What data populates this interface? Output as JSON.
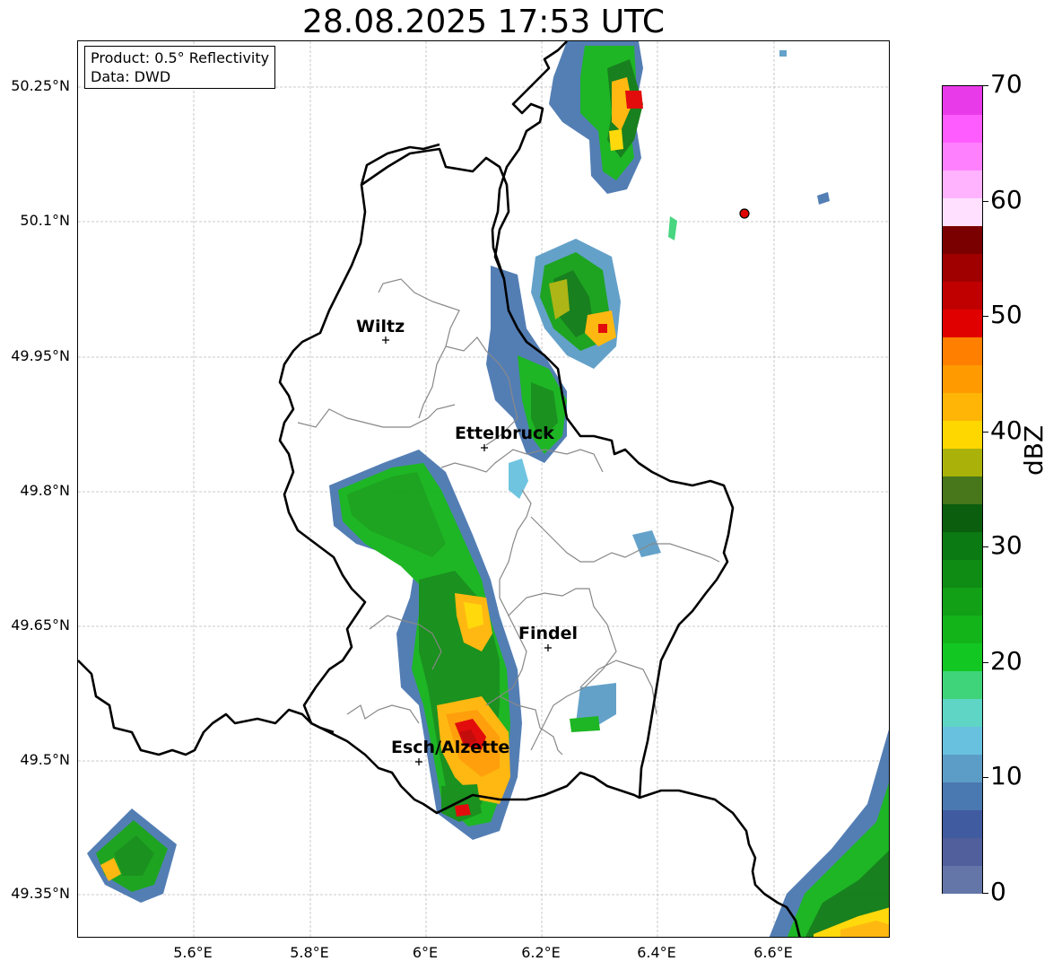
{
  "title": "28.08.2025 17:53 UTC",
  "info": {
    "product": "Product: 0.5° Reflectivity",
    "data": "Data: DWD"
  },
  "y_ticks": [
    "50.25°N",
    "50.1°N",
    "49.95°N",
    "49.8°N",
    "49.65°N",
    "49.5°N",
    "49.35°N"
  ],
  "x_ticks": [
    "5.6°E",
    "5.8°E",
    "6°E",
    "6.2°E",
    "6.4°E",
    "6.6°E"
  ],
  "cities": [
    "Wiltz",
    "Ettelbruck",
    "Findel",
    "Esch/Alzette"
  ],
  "colorbar": {
    "label": "dBZ",
    "ticks": [
      "0",
      "10",
      "20",
      "30",
      "40",
      "50",
      "60",
      "70"
    ],
    "colors": [
      "#6475a8",
      "#515f9c",
      "#405ba0",
      "#4a78b0",
      "#5c9dc7",
      "#68c1df",
      "#5fd6c5",
      "#3fd47a",
      "#12c722",
      "#13b31a",
      "#12a016",
      "#0f8c14",
      "#0c7a12",
      "#0a5e0e",
      "#47761b",
      "#aab20a",
      "#ffd700",
      "#ffb505",
      "#ff9a00",
      "#ff7f00",
      "#e10000",
      "#c00000",
      "#a10000",
      "#7a0000",
      "#ffe0ff",
      "#ffb3ff",
      "#ff80ff",
      "#ff5cff",
      "#e93ae9"
    ]
  },
  "radar_marker_color": "#e00000"
}
